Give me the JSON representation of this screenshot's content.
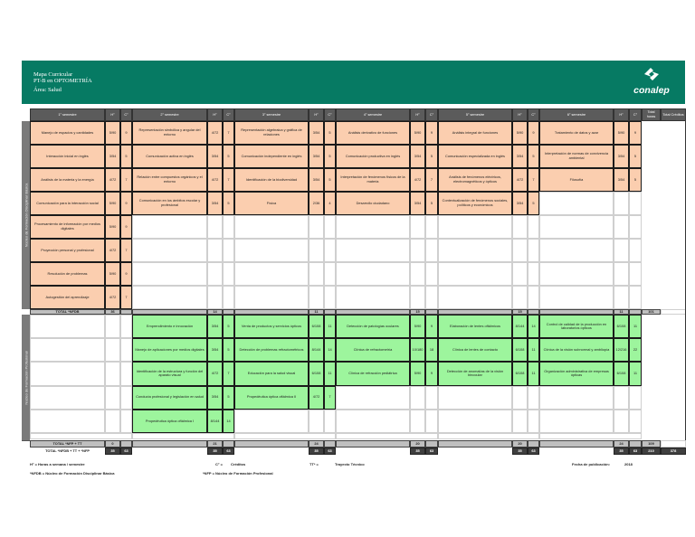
{
  "header": {
    "line1": "Mapa Curricular",
    "line2": "PT-B en OPTOMETRÍA",
    "area": "Área: Salud",
    "logo": "conalep"
  },
  "columns": {
    "semesters": [
      "1° semestre",
      "2° semestre",
      "3° semestre",
      "4° semestre",
      "5° semestre",
      "6° semestre"
    ],
    "h": "H°",
    "c": "C°",
    "total_hours": "Total horas",
    "total_credits": "Total Créditos"
  },
  "side_labels": {
    "nfdb": "Núcleo de Formación Disciplinar Básica",
    "nfp": "Núcleo de Formación Profesional"
  },
  "semesters": [
    {
      "nfdb": [
        {
          "name": "Manejo de espacios y cantidades",
          "h": "5/90",
          "c": "9"
        },
        {
          "name": "Interacción inicial en inglés",
          "h": "3/54",
          "c": "5"
        },
        {
          "name": "Análisis de la materia y la energía",
          "h": "4/72",
          "c": "7"
        },
        {
          "name": "Comunicación para la interacción social",
          "h": "5/90",
          "c": "9"
        },
        {
          "name": "Procesamiento de información por medios digitales",
          "h": "5/90",
          "c": "9"
        },
        {
          "name": "Proyección personal y profesional",
          "h": "4/72",
          "c": "7"
        },
        {
          "name": "Resolución de problemas",
          "h": "5/90",
          "c": "9"
        },
        {
          "name": "Autogestión del aprendizaje",
          "h": "4/72",
          "c": "7"
        }
      ],
      "nfp": []
    },
    {
      "nfdb": [
        {
          "name": "Representación simbólica y angular del entorno",
          "h": "4/72",
          "c": "7"
        },
        {
          "name": "Comunicación activa en inglés",
          "h": "3/54",
          "c": "5"
        },
        {
          "name": "Relación entre compuestos orgánicos y el entorno",
          "h": "4/72",
          "c": "7"
        },
        {
          "name": "Comunicación en los ámbitos escolar y profesional",
          "h": "3/54",
          "c": "5"
        }
      ],
      "nfp": [
        {
          "name": "Emprendimiento e innovación",
          "h": "3/54",
          "c": "5"
        },
        {
          "name": "Manejo de aplicaciones por medios digitales",
          "h": "3/54",
          "c": "5"
        },
        {
          "name": "Identificación de la estructura y función del aparato visual",
          "h": "4/72",
          "c": "7"
        },
        {
          "name": "Conducta profesional y legislación en salud",
          "h": "3/54",
          "c": "5"
        },
        {
          "name": "Propedéutica óptica oftálmica I",
          "h": "8/144",
          "c": "14"
        }
      ]
    },
    {
      "nfdb": [
        {
          "name": "Representación algebraica y gráfica de relaciones",
          "h": "3/54",
          "c": "5"
        },
        {
          "name": "Comunicación independiente en inglés",
          "h": "3/54",
          "c": "5"
        },
        {
          "name": "Identificación de la biodiversidad",
          "h": "3/54",
          "c": "5"
        },
        {
          "name": "Física",
          "h": "2/36",
          "c": "4"
        }
      ],
      "nfp": [
        {
          "name": "Venta de productos y servicios ópticos",
          "h": "6/108",
          "c": "11"
        },
        {
          "name": "Detección de problemas refractométricos",
          "h": "8/144",
          "c": "14"
        },
        {
          "name": "Educación para la salud visual",
          "h": "6/108",
          "c": "11"
        },
        {
          "name": "Propedéutica óptica oftálmica II",
          "h": "4/72",
          "c": "7"
        }
      ]
    },
    {
      "nfdb": [
        {
          "name": "Análisis derivativo de funciones",
          "h": "5/90",
          "c": "9"
        },
        {
          "name": "Comunicación productiva en inglés",
          "h": "3/54",
          "c": "5"
        },
        {
          "name": "Interpretación de fenómenos físicos de la materia",
          "h": "4/72",
          "c": "7"
        },
        {
          "name": "Desarrollo ciudadano",
          "h": "3/54",
          "c": "5"
        }
      ],
      "nfp": [
        {
          "name": "Detección de patologías oculares",
          "h": "5/90",
          "c": "9"
        },
        {
          "name": "Clínica de refractometría",
          "h": "10/180",
          "c": "18"
        },
        {
          "name": "Clínica de refracción pediátrica",
          "h": "5/90",
          "c": "9"
        }
      ]
    },
    {
      "nfdb": [
        {
          "name": "Análisis integral de funciones",
          "h": "5/90",
          "c": "9"
        },
        {
          "name": "Comunicación especializada en inglés",
          "h": "3/54",
          "c": "5"
        },
        {
          "name": "Análisis de fenómenos eléctricos, electromagnéticos y ópticos",
          "h": "4/72",
          "c": "7"
        },
        {
          "name": "Contextualización de fenómenos sociales, políticos y económicos",
          "h": "3/54",
          "c": "5"
        }
      ],
      "nfp": [
        {
          "name": "Elaboración de lentes oftálmicos",
          "h": "8/144",
          "c": "14"
        },
        {
          "name": "Clínica de lentes de contacto",
          "h": "6/108",
          "c": "11"
        },
        {
          "name": "Detección de anomalías de la visión binocular",
          "h": "6/108",
          "c": "11"
        }
      ]
    },
    {
      "nfdb": [
        {
          "name": "Tratamiento de datos y azar",
          "h": "5/90",
          "c": "9"
        },
        {
          "name": "Interpretación de normas de convivencia ambiental",
          "h": "3/54",
          "c": "5"
        },
        {
          "name": "Filosofía",
          "h": "3/54",
          "c": "5"
        }
      ],
      "nfp": [
        {
          "name": "Control de calidad de la producción en laboratorios ópticos",
          "h": "6/108",
          "c": "11"
        },
        {
          "name": "Clínica de la visión subnormal y ambliopía",
          "h": "12/216",
          "c": "22"
        },
        {
          "name": "Organización administrativa de empresas ópticas",
          "h": "6/108",
          "c": "11"
        }
      ]
    }
  ],
  "totals": {
    "nfdb": {
      "label": "TOTAL *NFDB",
      "values": [
        "36",
        "14",
        "11",
        "15",
        "15",
        "11"
      ],
      "total": "101"
    },
    "nfp": {
      "label": "TOTAL *NFP + TT",
      "values": [
        "0",
        "21",
        "24",
        "20",
        "20",
        "24"
      ],
      "total": "109"
    },
    "all": {
      "label": "TOTAL *NFDB + TT + *NFP",
      "values": [
        [
          "35",
          "63"
        ],
        [
          "35",
          "63"
        ],
        [
          "35",
          "63"
        ],
        [
          "35",
          "63"
        ],
        [
          "35",
          "63"
        ],
        [
          "35",
          "63"
        ]
      ],
      "hours": "210",
      "credits": "378"
    }
  },
  "legend": {
    "h": "H° = Horas a semana / semestre",
    "c_key": "C° =",
    "c_val": "Créditos",
    "tt_key": "TT* =",
    "tt_val": "Trayecto Técnico",
    "date_label": "Fecha de publicación:",
    "date": "2018",
    "nfdb": "*NFDB = Núcleo de Formación Disciplinar Básica",
    "nfp": "*NFP = Núcleo de Formación Profesional"
  },
  "colors": {
    "header": "#067a63",
    "nfdb": "#fbceaf",
    "nfp": "#9df59d",
    "table_header": "#5b5b5b"
  }
}
